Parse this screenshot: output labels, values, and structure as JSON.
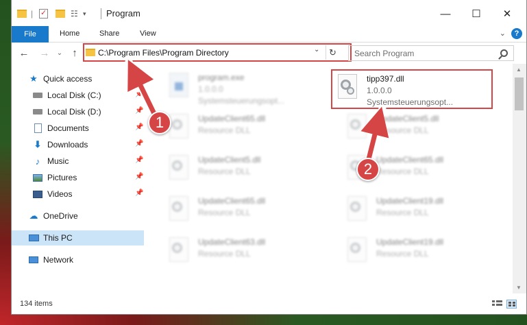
{
  "window": {
    "title": "Program"
  },
  "ribbon": {
    "tabs": [
      {
        "label": "File"
      },
      {
        "label": "Home"
      },
      {
        "label": "Share"
      },
      {
        "label": "View"
      }
    ]
  },
  "address": {
    "path": "C:\\Program Files\\Program Directory"
  },
  "search": {
    "placeholder": "Search Program"
  },
  "sidebar": {
    "items": [
      {
        "label": "Quick access",
        "icon": "star-icon"
      },
      {
        "label": "Local Disk (C:)",
        "icon": "drive-icon",
        "pinned": true
      },
      {
        "label": "Local Disk (D:)",
        "icon": "drive-icon",
        "pinned": true
      },
      {
        "label": "Documents",
        "icon": "documents-icon",
        "pinned": true
      },
      {
        "label": "Downloads",
        "icon": "download-icon",
        "pinned": true
      },
      {
        "label": "Music",
        "icon": "music-icon",
        "pinned": true
      },
      {
        "label": "Pictures",
        "icon": "pictures-icon",
        "pinned": true
      },
      {
        "label": "Videos",
        "icon": "videos-icon",
        "pinned": true
      },
      {
        "label": "OneDrive",
        "icon": "cloud-icon"
      },
      {
        "label": "This PC",
        "icon": "computer-icon",
        "selected": true
      },
      {
        "label": "Network",
        "icon": "network-icon"
      }
    ]
  },
  "files": [
    {
      "name": "program.exe",
      "line2": "1.0.0.0",
      "line3": "Systemsteuerungsopt...",
      "blurred": true
    },
    {
      "name": "tipp397.dll",
      "line2": "1.0.0.0",
      "line3": "Systemsteuerungsopt...",
      "blurred": false,
      "highlighted": true
    },
    {
      "name": "UpdateClient65.dll",
      "line2": "Resource DLL",
      "blurred": true
    },
    {
      "name": "UpdateClient5.dll",
      "line2": "Resource DLL",
      "blurred": true
    },
    {
      "name": "UpdateClient5.dll",
      "line2": "Resource DLL",
      "blurred": true
    },
    {
      "name": "UpdateClient65.dll",
      "line2": "Resource DLL",
      "blurred": true
    },
    {
      "name": "UpdateClient65.dll",
      "line2": "Resource DLL",
      "blurred": true
    },
    {
      "name": "UpdateClient19.dll",
      "line2": "Resource DLL",
      "blurred": true
    },
    {
      "name": "UpdateClient63.dll",
      "line2": "Resource DLL",
      "blurred": true
    },
    {
      "name": "UpdateClient19.dll",
      "line2": "Resource DLL",
      "blurred": true
    }
  ],
  "status": {
    "item_count": "134 items"
  },
  "annotations": {
    "step1": "1",
    "step2": "2",
    "color": "#d64545"
  }
}
